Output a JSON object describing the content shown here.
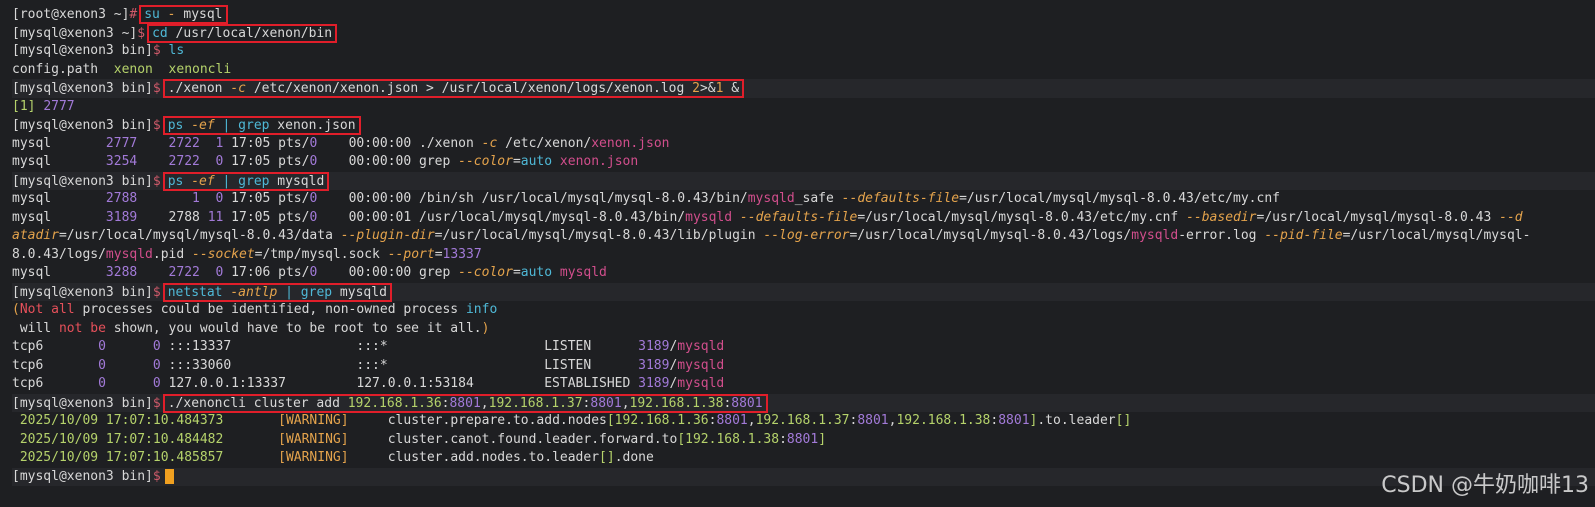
{
  "terminal": {
    "lines": [
      {
        "id": "l1",
        "text": "[root@xenon3 ~]# su - mysql"
      },
      {
        "id": "l2",
        "text": "[mysql@xenon3 ~]$ cd /usr/local/xenon/bin"
      },
      {
        "id": "l3",
        "text": "[mysql@xenon3 bin]$ ls"
      },
      {
        "id": "l4",
        "text": "config.path  xenon  xenoncli"
      },
      {
        "id": "l5",
        "text": "[mysql@xenon3 bin]$ ./xenon -c /etc/xenon/xenon.json > /usr/local/xenon/logs/xenon.log 2>&1 &"
      },
      {
        "id": "l6",
        "text": "[1] 2777"
      },
      {
        "id": "l7",
        "text": "[mysql@xenon3 bin]$ ps -ef | grep xenon.json"
      },
      {
        "id": "l8",
        "text": "mysql       2777    2722  1 17:05 pts/0    00:00:00 ./xenon -c /etc/xenon/xenon.json"
      },
      {
        "id": "l9",
        "text": "mysql       3254    2722  0 17:05 pts/0    00:00:00 grep --color=auto xenon.json"
      },
      {
        "id": "l10",
        "text": "[mysql@xenon3 bin]$ ps -ef | grep mysqld"
      },
      {
        "id": "l11",
        "text": "mysql       2788       1  0 17:05 pts/0    00:00:00 /bin/sh /usr/local/mysql/mysql-8.0.43/bin/mysqld_safe --defaults-file=/usr/local/mysql/mysql-8.0.43/etc/my.cnf"
      },
      {
        "id": "l12",
        "text": "mysql       3189    2788 11 17:05 pts/0    00:00:01 /usr/local/mysql/mysql-8.0.43/bin/mysqld --defaults-file=/usr/local/mysql/mysql-8.0.43/etc/my.cnf --basedir=/usr/local/mysql/mysql-8.0.43 --d"
      },
      {
        "id": "l13",
        "text": "atadir=/usr/local/mysql/mysql-8.0.43/data --plugin-dir=/usr/local/mysql/mysql-8.0.43/lib/plugin --log-error=/usr/local/mysql/mysql-8.0.43/logs/mysqld-error.log --pid-file=/usr/local/mysql/mysql-"
      },
      {
        "id": "l14",
        "text": "8.0.43/logs/mysqld.pid --socket=/tmp/mysql.sock --port=13337"
      },
      {
        "id": "l15",
        "text": "mysql       3288    2722  0 17:06 pts/0    00:00:00 grep --color=auto mysqld"
      },
      {
        "id": "l16",
        "text": "[mysql@xenon3 bin]$ netstat -antlp | grep mysqld"
      },
      {
        "id": "l17",
        "text": "(Not all processes could be identified, non-owned process info"
      },
      {
        "id": "l18",
        "text": " will not be shown, you would have to be root to see it all.)"
      },
      {
        "id": "l19",
        "text": "tcp6       0      0 :::13337                :::*                    LISTEN      3189/mysqld"
      },
      {
        "id": "l20",
        "text": "tcp6       0      0 :::33060                :::*                    LISTEN      3189/mysqld"
      },
      {
        "id": "l21",
        "text": "tcp6       0      0 127.0.0.1:13337         127.0.0.1:53184         ESTABLISHED 3189/mysqld"
      },
      {
        "id": "l22",
        "text": "[mysql@xenon3 bin]$ ./xenoncli cluster add 192.168.1.36:8801,192.168.1.37:8801,192.168.1.38:8801"
      },
      {
        "id": "l23",
        "text": " 2025/10/09 17:07:10.484373       [WARNING]     cluster.prepare.to.add.nodes[192.168.1.36:8801,192.168.1.37:8801,192.168.1.38:8801].to.leader[]"
      },
      {
        "id": "l24",
        "text": " 2025/10/09 17:07:10.484482       [WARNING]     cluster.canot.found.leader.forward.to[192.168.1.38:8801]"
      },
      {
        "id": "l25",
        "text": " 2025/10/09 17:07:10.485857       [WARNING]     cluster.add.nodes.to.leader[].done"
      },
      {
        "id": "l26",
        "text": "[mysql@xenon3 bin]$ "
      }
    ]
  },
  "watermark": "CSDN @牛奶咖啡13",
  "colors": {
    "background": "#1e1f22",
    "highlight_box": "#e01e2a",
    "command": "#4fb8d6",
    "option": "#e4a34c",
    "match": "#d14e8c",
    "number": "#a27ad8",
    "path_green": "#b5d26b",
    "cursor": "#f0a020"
  }
}
